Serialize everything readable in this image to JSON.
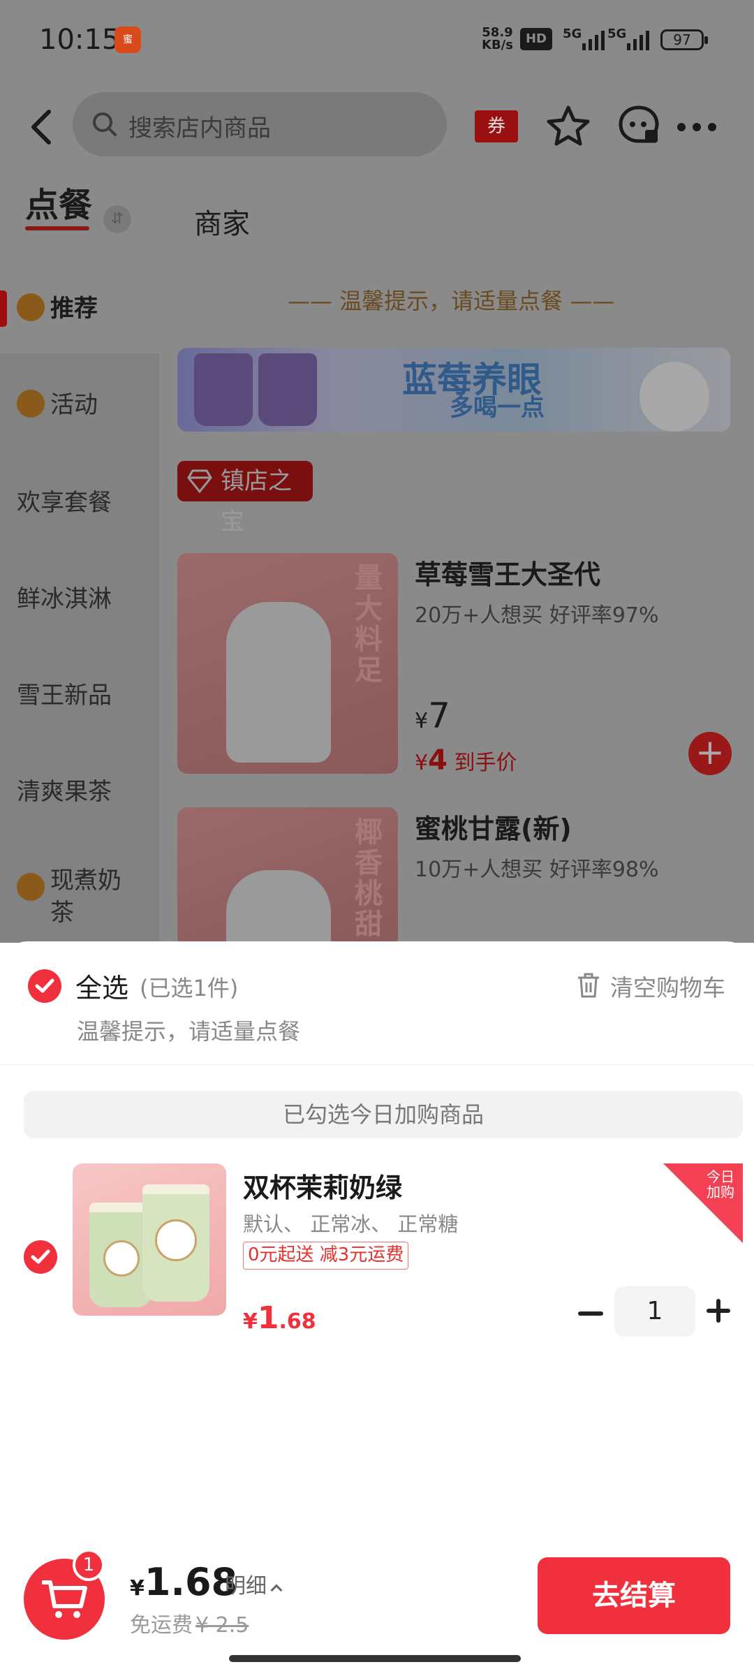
{
  "status_bar": {
    "time": "10:15",
    "net_speed_value": "58.9",
    "net_speed_unit": "KB/s",
    "hd_label": "HD",
    "sig1": "5G",
    "sig2": "5G",
    "battery": "97",
    "app_badge_icon": "app-badge-icon"
  },
  "header": {
    "search_placeholder": "搜索店内商品",
    "coupon_label": "券"
  },
  "tabs": {
    "order": "点餐",
    "merchant": "商家"
  },
  "sidebar": {
    "items": [
      {
        "label": "推荐",
        "icon": "recommend-icon"
      },
      {
        "label": "活动",
        "icon": "event-icon"
      },
      {
        "label": "欢享套餐"
      },
      {
        "label": "鲜冰淇淋"
      },
      {
        "label": "雪王新品"
      },
      {
        "label": "清爽果茶"
      },
      {
        "label": "现煮奶",
        "label2": "茶",
        "icon": "milk-tea-icon"
      }
    ]
  },
  "menu": {
    "tip": "—— 温馨提示，请适量点餐 ——",
    "banner_title": "蓝莓养眼",
    "banner_sub": "多喝一点",
    "section_tag": "镇店之宝",
    "products": [
      {
        "name": "草莓雪王大圣代",
        "meta": "20万+人想买  好评率97%",
        "price": "7",
        "deal_price": "4",
        "deal_suffix": "到手价",
        "image_text": "量大料足"
      },
      {
        "name": "蜜桃甘露(新)",
        "meta": "10万+人想买  好评率98%",
        "image_text": "椰香桃甜"
      }
    ]
  },
  "cart": {
    "select_all": "全选",
    "selected_count": "(已选1件)",
    "clear_label": "清空购物车",
    "tip": "温馨提示，请适量点餐",
    "today_bar": "已勾选今日加购商品",
    "item": {
      "name": "双杯茉莉奶绿",
      "spec": "默认、 正常冰、 正常糖",
      "promo": "0元起送 减3元运费",
      "price_int": "1",
      "price_dec": ".68",
      "currency": "¥",
      "tag": "今日加购",
      "quantity": "1"
    }
  },
  "footer": {
    "badge": "1",
    "currency": "¥",
    "total": "1.68",
    "detail_label": "明细",
    "shipping_label": "免运费",
    "shipping_orig": "¥ 2.5",
    "checkout_label": "去结算"
  },
  "colors": {
    "accent": "#f0303c",
    "overlay": "#8a8a8a"
  }
}
